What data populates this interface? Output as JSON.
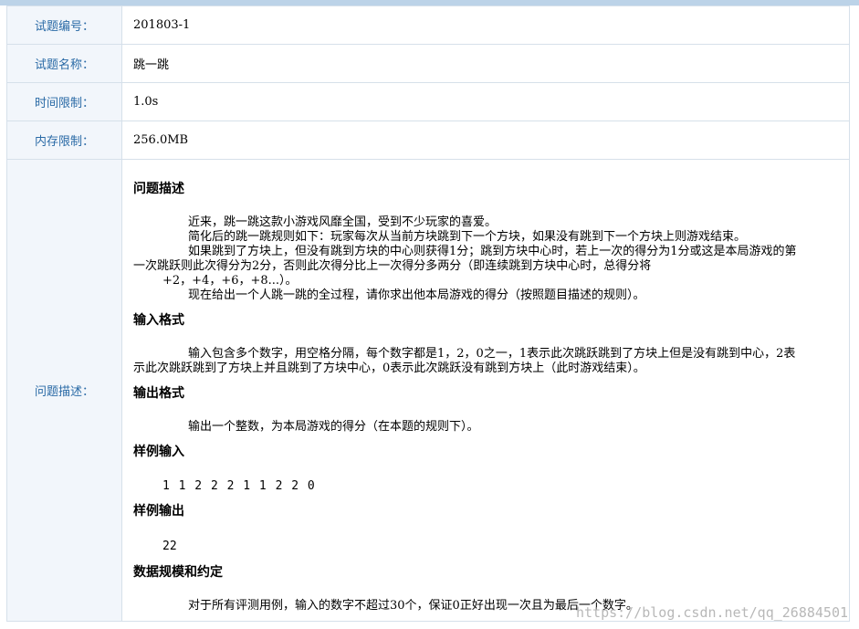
{
  "rows": [
    {
      "label": "试题编号：",
      "value": "201803-1"
    },
    {
      "label": "试题名称：",
      "value": "跳一跳"
    },
    {
      "label": "时间限制：",
      "value": "1.0s"
    },
    {
      "label": "内存限制：",
      "value": "256.0MB"
    }
  ],
  "description": {
    "label": "问题描述：",
    "problem_title": "问题描述",
    "problem_lines": [
      "近来，跳一跳这款小游戏风靡全国，受到不少玩家的喜爱。",
      "简化后的跳一跳规则如下：玩家每次从当前方块跳到下一个方块，如果没有跳到下一个方块上则游戏结束。",
      "如果跳到了方块上，但没有跳到方块的中心则获得1分；跳到方块中心时，若上一次的得分为1分或这是本局游戏的第",
      "一次跳跃则此次得分为2分，否则此次得分比上一次得分多两分（即连续跳到方块中心时，总得分将",
      "+2，+4，+6，+8...）。",
      "现在给出一个人跳一跳的全过程，请你求出他本局游戏的得分（按照题目描述的规则）。"
    ],
    "input_title": "输入格式",
    "input_lines": [
      "输入包含多个数字，用空格分隔，每个数字都是1，2，0之一，1表示此次跳跃跳到了方块上但是没有跳到中心，2表",
      "示此次跳跃跳到了方块上并且跳到了方块中心，0表示此次跳跃没有跳到方块上（此时游戏结束）。"
    ],
    "output_title": "输出格式",
    "output_line": "输出一个整数，为本局游戏的得分（在本题的规则下）。",
    "sample_input_title": "样例输入",
    "sample_input": "1 1 2 2 2 1 1 2 2 0",
    "sample_output_title": "样例输出",
    "sample_output": "22",
    "scale_title": "数据规模和约定",
    "scale_line": "对于所有评测用例，输入的数字不超过30个，保证0正好出现一次且为最后一个数字。"
  },
  "watermark": "https://blog.csdn.net/qq_26884501"
}
